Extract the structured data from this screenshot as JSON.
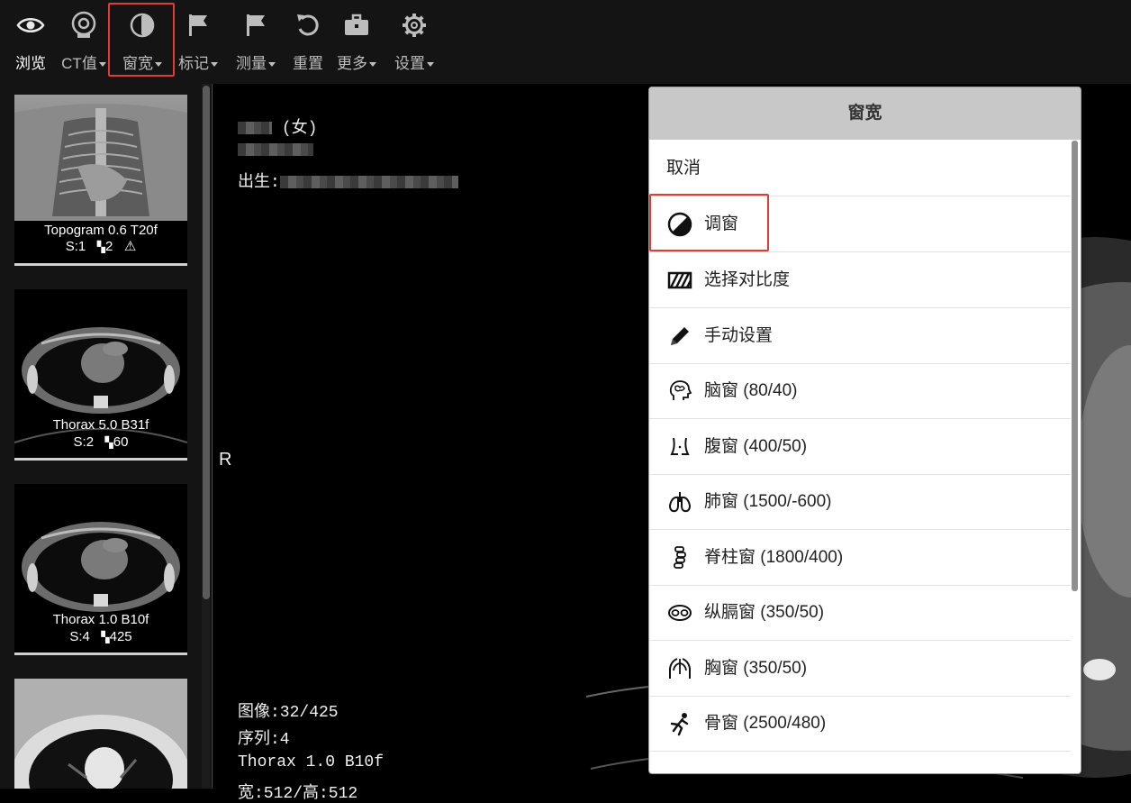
{
  "toolbar": {
    "items": [
      {
        "label": "浏览",
        "icon": "eye-icon",
        "caret": false,
        "active": true
      },
      {
        "label": "CT值",
        "icon": "ct-probe-icon",
        "caret": true
      },
      {
        "label": "窗宽",
        "icon": "contrast-circle-icon",
        "caret": true
      },
      {
        "label": "标记",
        "icon": "flag-icon",
        "caret": true
      },
      {
        "label": "测量",
        "icon": "flag-icon",
        "caret": true
      },
      {
        "label": "重置",
        "icon": "reset-icon",
        "caret": false
      },
      {
        "label": "更多",
        "icon": "briefcase-icon",
        "caret": true
      },
      {
        "label": "设置",
        "icon": "gear-icon",
        "caret": true
      }
    ]
  },
  "series": [
    {
      "name": "Topogram 0.6 T20f",
      "number": "S:1",
      "count": "2",
      "warning": true
    },
    {
      "name": "Thorax 5.0 B31f",
      "number": "S:2",
      "count": "60",
      "warning": false
    },
    {
      "name": "Thorax 1.0 B10f",
      "number": "S:4",
      "count": "425",
      "warning": false
    }
  ],
  "viewer": {
    "patient_sex": "(女)",
    "birth_label": "出生:",
    "orientation_left": "R",
    "image_info": "图像:32/425",
    "series_info": "序列:4",
    "series_desc": "Thorax 1.0 B10f",
    "size_info": "宽:512/高:512"
  },
  "window_menu": {
    "title": "窗宽",
    "items": [
      {
        "label": "取消",
        "icon": ""
      },
      {
        "label": "调窗",
        "icon": "window-adjust-icon"
      },
      {
        "label": "选择对比度",
        "icon": "contrast-hatch-icon"
      },
      {
        "label": "手动设置",
        "icon": "pencil-icon"
      },
      {
        "label": "脑窗 (80/40)",
        "icon": "brain-icon"
      },
      {
        "label": "腹窗 (400/50)",
        "icon": "abdomen-icon"
      },
      {
        "label": "肺窗 (1500/-600)",
        "icon": "lungs-icon"
      },
      {
        "label": "脊柱窗 (1800/400)",
        "icon": "spine-icon"
      },
      {
        "label": "纵膈窗 (350/50)",
        "icon": "mediastinum-icon"
      },
      {
        "label": "胸窗 (350/50)",
        "icon": "chest-icon"
      },
      {
        "label": "骨窗 (2500/480)",
        "icon": "bone-icon"
      }
    ]
  }
}
